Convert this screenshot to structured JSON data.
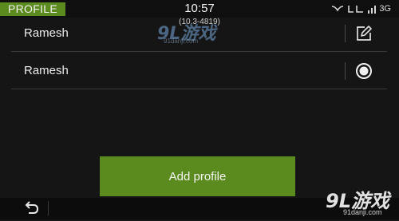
{
  "status_bar": {
    "section_label": "PROFILE",
    "time": "10:57",
    "sub_text": "(10.3-4819)",
    "network_label": "3G"
  },
  "profiles": [
    {
      "name": "Ramesh",
      "action_icon": "edit-icon"
    },
    {
      "name": "Ramesh",
      "action_icon": "radio-selected-icon"
    }
  ],
  "add_profile_label": "Add profile",
  "bottom_bar": {
    "back_icon": "back-arrow-icon"
  },
  "watermark": {
    "top_logo": "9L游戏",
    "top_url": "91danji.com",
    "bottom_logo": "9L游戏",
    "bottom_url": "91danji.com"
  },
  "colors": {
    "accent": "#5b8a1f",
    "background": "#151515",
    "text": "#e8e8e8"
  }
}
